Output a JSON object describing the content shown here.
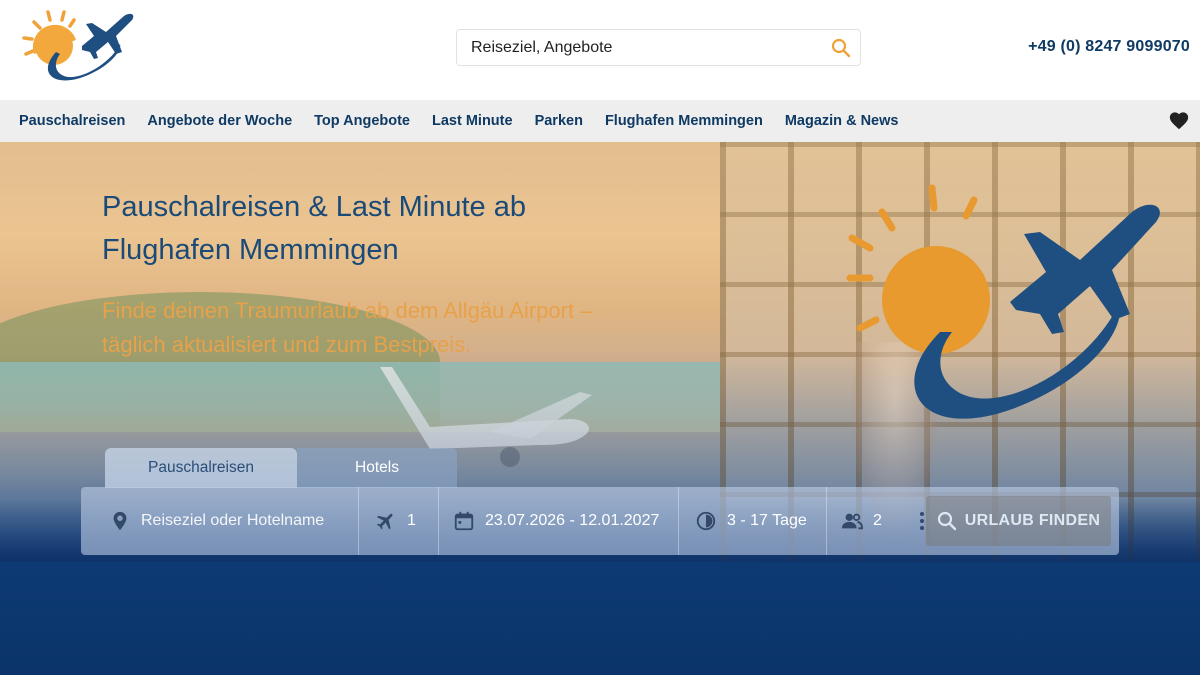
{
  "header": {
    "search": {
      "value": "Reiseziel, Angebote",
      "icon": "search-icon"
    },
    "phone": "+49 (0) 8247 9099070"
  },
  "nav": {
    "items": [
      {
        "label": "Pauschalreisen"
      },
      {
        "label": "Angebote der Woche"
      },
      {
        "label": "Top Angebote"
      },
      {
        "label": "Last Minute"
      },
      {
        "label": "Parken"
      },
      {
        "label": "Flughafen Memmingen"
      },
      {
        "label": "Magazin & News"
      }
    ],
    "favorites_icon": "heart-icon"
  },
  "hero": {
    "title_line1": "Pauschalreisen & Last Minute ab",
    "title_line2": "Flughafen Memmingen",
    "subtitle_line1": "Finde deinen Traumurlaub ab dem Allgäu Airport –",
    "subtitle_line2": "täglich aktualisiert und zum Bestpreis."
  },
  "booking": {
    "tabs": [
      {
        "label": "Pauschalreisen",
        "active": true
      },
      {
        "label": "Hotels",
        "active": false
      }
    ],
    "destination_placeholder": "Reiseziel oder Hotelname",
    "airports": "1",
    "dates": "23.07.2026 - 12.01.2027",
    "duration": "3 - 17 Tage",
    "persons": "2",
    "submit_label": "URLAUB FINDEN"
  },
  "colors": {
    "brand_blue": "#0f3a63",
    "brand_orange": "#e7a14a",
    "nav_bg": "#eeeeee",
    "footer_blue": "#0e3a74"
  }
}
